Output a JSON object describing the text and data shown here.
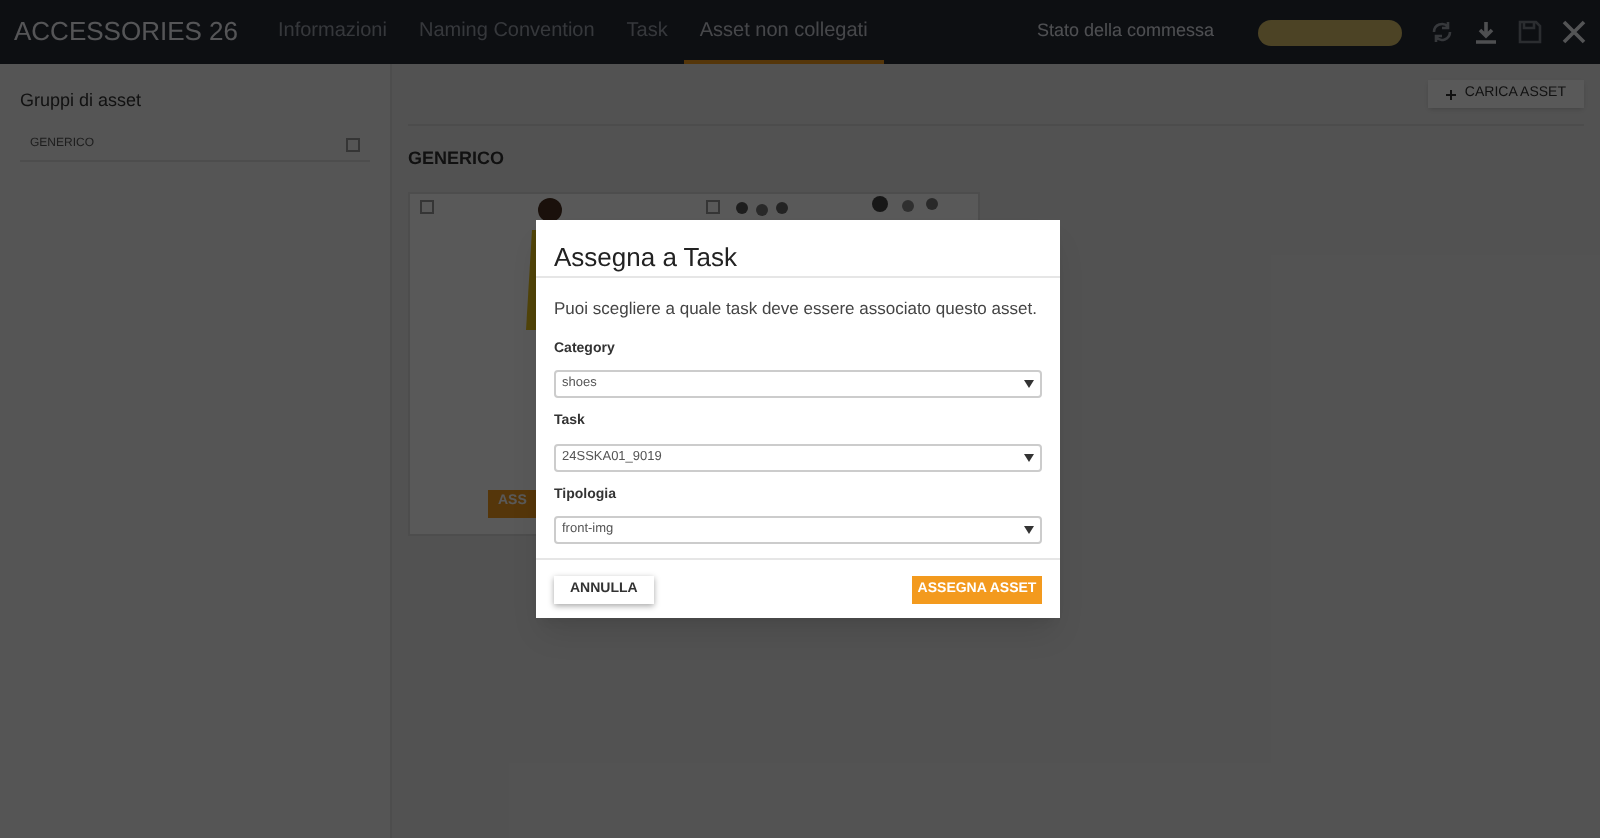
{
  "header": {
    "project": "ACCESSORIES 26",
    "tabs": [
      {
        "label": "Informazioni",
        "selected": false
      },
      {
        "label": "Naming Convention",
        "selected": false
      },
      {
        "label": "Task",
        "selected": false
      },
      {
        "label": "Asset non collegati",
        "selected": true
      }
    ],
    "status_label": "Stato della commessa"
  },
  "sidebar": {
    "title": "Gruppi di asset",
    "items": [
      {
        "label": "GENERICO",
        "checked": false
      }
    ]
  },
  "main": {
    "upload_button": "CARICA ASSET",
    "group_title": "GENERICO",
    "card_button": "ASS",
    "assets": [
      {
        "checked": false
      },
      {
        "checked": false
      }
    ]
  },
  "dialog": {
    "title": "Assegna a Task",
    "message": "Puoi scegliere a quale task deve essere associato questo asset.",
    "fields": [
      {
        "label": "Category",
        "value": "shoes"
      },
      {
        "label": "Task",
        "value": "24SSKA01_9019"
      },
      {
        "label": "Tipologia",
        "value": "front-img"
      }
    ],
    "cancel": "ANNULLA",
    "confirm": "ASSEGNA ASSET"
  }
}
